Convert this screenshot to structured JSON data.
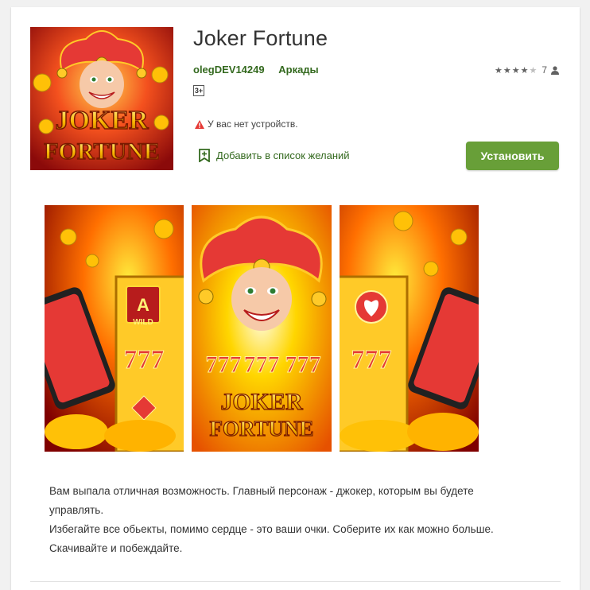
{
  "app": {
    "title": "Joker Fortune",
    "developer": "olegDEV14249",
    "category": "Аркады",
    "age_rating": "3+",
    "rating_count": "7",
    "rating_stars": 3.5,
    "warning": "У вас нет устройств.",
    "wishlist_label": "Добавить в список желаний",
    "install_label": "Установить",
    "icon_text": [
      "JOKER",
      "FORTUNE"
    ]
  },
  "screenshots": [
    {
      "name": "screenshot-1",
      "badge": "A",
      "badge_sub": "WILD",
      "seven": "777"
    },
    {
      "name": "screenshot-2",
      "logo": [
        "JOKER",
        "FORTUNE"
      ],
      "seven": "777"
    },
    {
      "name": "screenshot-3",
      "seven": "777"
    }
  ],
  "description": [
    "Вам выпала отличная возможность. Главный персонаж - джокер, которым вы будете управлять.",
    "Избегайте все обьекты, помимо сердце - это ваши очки. Соберите их как можно больше.",
    "Скачивайте и побеждайте."
  ],
  "colors": {
    "accent": "#689f38",
    "link": "#33691e",
    "warning": "#e53935"
  }
}
